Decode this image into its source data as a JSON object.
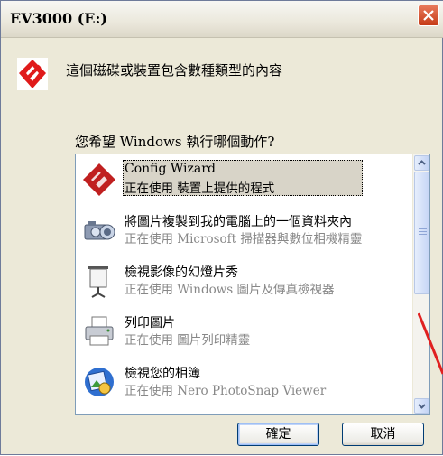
{
  "window": {
    "title": "EV3000 (E:)"
  },
  "header": {
    "text": "這個磁碟或裝置包含數種類型的內容"
  },
  "question": "您希望 Windows 執行哪個動作?",
  "actions": [
    {
      "title": "Config Wizard",
      "subtitle": "正在使用 裝置上提供的程式",
      "icon": "config-wizard-icon",
      "selected": true
    },
    {
      "title": "將圖片複製到我的電腦上的一個資料夾內",
      "subtitle": "正在使用 Microsoft 掃描器與數位相機精靈",
      "icon": "camera-icon",
      "selected": false
    },
    {
      "title": "檢視影像的幻燈片秀",
      "subtitle": "正在使用 Windows 圖片及傳真檢視器",
      "icon": "projector-screen-icon",
      "selected": false
    },
    {
      "title": "列印圖片",
      "subtitle": "正在使用 圖片列印精靈",
      "icon": "printer-icon",
      "selected": false
    },
    {
      "title": "檢視您的相簿",
      "subtitle": "正在使用 Nero PhotoSnap Viewer",
      "icon": "photo-album-icon",
      "selected": false
    }
  ],
  "buttons": {
    "ok": "確定",
    "cancel": "取消"
  },
  "colors": {
    "logo_red": "#e01a1a",
    "annotation_red": "#e02020",
    "close_red": "#c63b17"
  }
}
